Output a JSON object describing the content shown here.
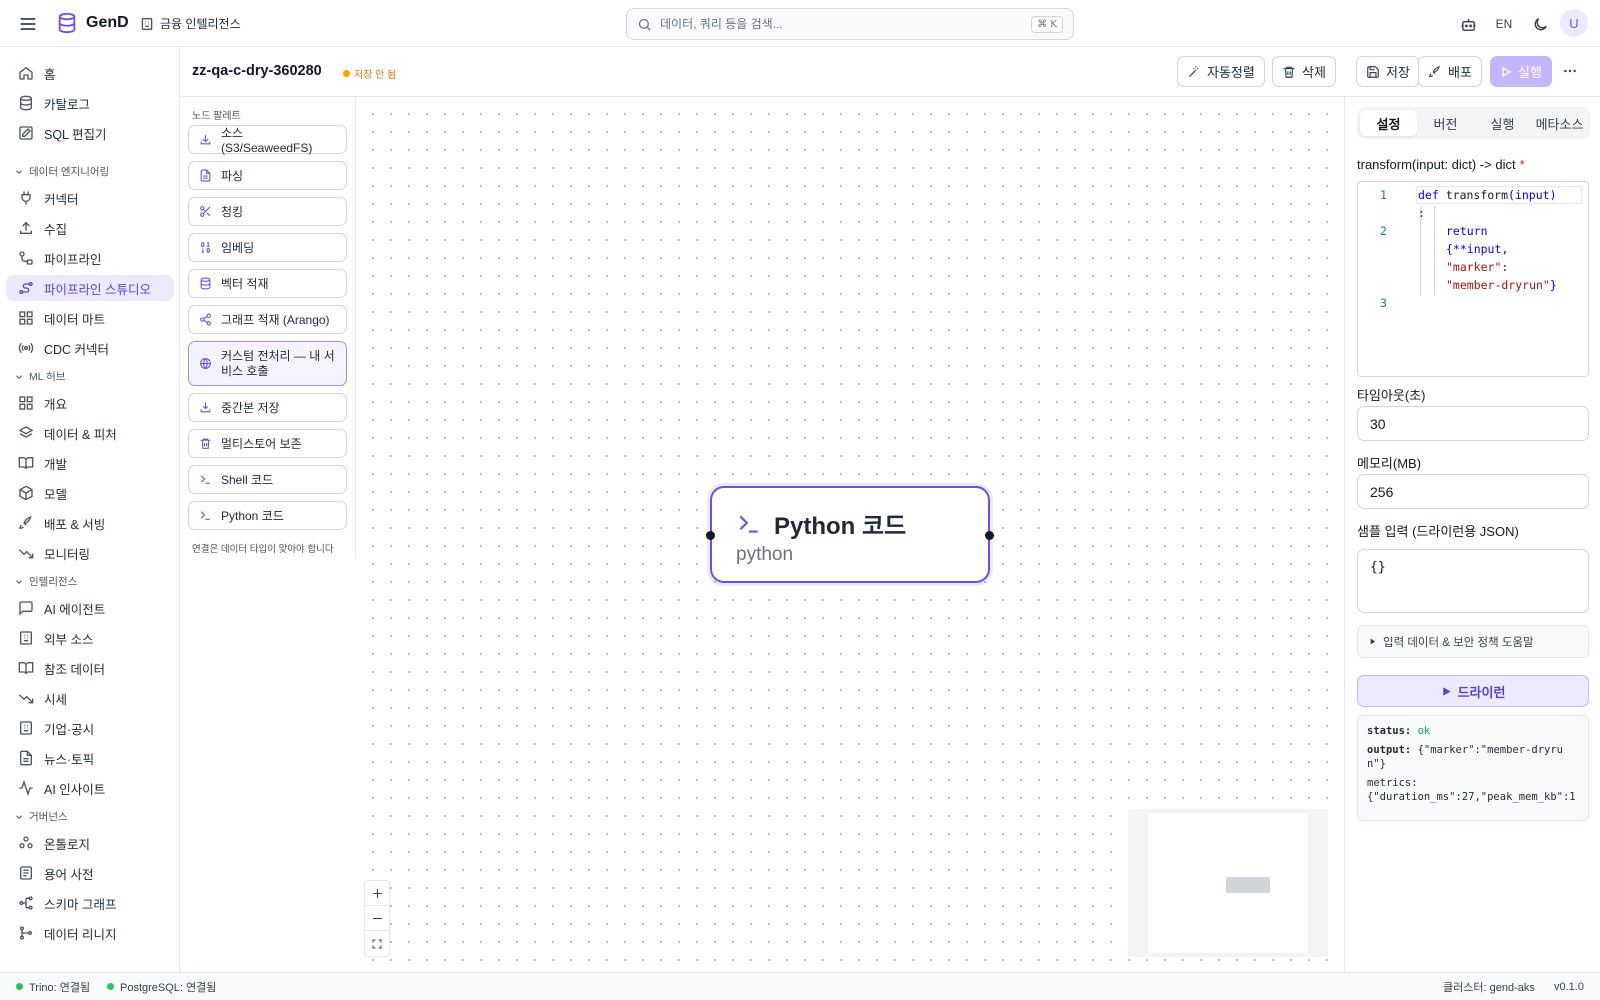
{
  "app": {
    "brand": "GenD",
    "org": "금융 인텔리전스",
    "search_placeholder": "데이터, 쿼리 등을 검색...",
    "search_shortcut": "⌘ K",
    "lang": "EN",
    "avatar": "U"
  },
  "sidebar": {
    "items_top": [
      {
        "label": "홈",
        "icon": "home-icon"
      },
      {
        "label": "카탈로그",
        "icon": "database-icon"
      },
      {
        "label": "SQL 편집기",
        "icon": "edit-icon"
      }
    ],
    "sections": [
      {
        "title": "데이터 엔지니어링",
        "items": [
          {
            "label": "커넥터",
            "icon": "plug-icon"
          },
          {
            "label": "수집",
            "icon": "upload-icon"
          },
          {
            "label": "파이프라인",
            "icon": "workflow-icon"
          },
          {
            "label": "파이프라인 스튜디오",
            "icon": "route-icon",
            "active": true
          },
          {
            "label": "데이터 마트",
            "icon": "grid-icon"
          },
          {
            "label": "CDC 커넥터",
            "icon": "radio-icon"
          }
        ]
      },
      {
        "title": "ML 허브",
        "items": [
          {
            "label": "개요",
            "icon": "grid-icon"
          },
          {
            "label": "데이터 & 피처",
            "icon": "layers-icon"
          },
          {
            "label": "개발",
            "icon": "book-icon"
          },
          {
            "label": "모델",
            "icon": "box-icon"
          },
          {
            "label": "배포 & 서빙",
            "icon": "rocket-icon"
          },
          {
            "label": "모니터링",
            "icon": "trend-icon"
          }
        ]
      },
      {
        "title": "인텔리전스",
        "items": [
          {
            "label": "AI 에이전트",
            "icon": "chat-icon"
          },
          {
            "label": "외부 소스",
            "icon": "building-icon"
          },
          {
            "label": "참조 데이터",
            "icon": "book-icon"
          },
          {
            "label": "시세",
            "icon": "trend-icon"
          },
          {
            "label": "기업·공시",
            "icon": "building-icon"
          },
          {
            "label": "뉴스·토픽",
            "icon": "file-icon"
          },
          {
            "label": "AI 인사이트",
            "icon": "activity-icon"
          }
        ]
      },
      {
        "title": "거버넌스",
        "items": [
          {
            "label": "온톨로지",
            "icon": "ontology-icon"
          },
          {
            "label": "용어 사전",
            "icon": "list-icon"
          },
          {
            "label": "스키마 그래프",
            "icon": "schema-icon"
          },
          {
            "label": "데이터 리니지",
            "icon": "lineage-icon"
          }
        ]
      }
    ]
  },
  "header": {
    "pipeline_name": "zz-qa-c-dry-360280",
    "unsaved": "저장 안 됨",
    "buttons": {
      "autolayout": "자동정렬",
      "delete": "삭제",
      "save": "저장",
      "deploy": "배포",
      "run": "실행"
    }
  },
  "palette": {
    "title": "노드 팔레트",
    "items": [
      {
        "label": "소스 (S3/SeaweedFS)",
        "icon": "download-icon"
      },
      {
        "label": "파싱",
        "icon": "file-icon"
      },
      {
        "label": "청킹",
        "icon": "scissors-icon"
      },
      {
        "label": "임베딩",
        "icon": "binary-icon"
      },
      {
        "label": "벡터 적재",
        "icon": "database-icon"
      },
      {
        "label": "그래프 적재 (Arango)",
        "icon": "share-icon"
      },
      {
        "label": "커스텀 전처리 — 내 서비스 호출",
        "icon": "globe-icon"
      },
      {
        "label": "중간본 저장",
        "icon": "save-down-icon"
      },
      {
        "label": "멀티스토어 보존",
        "icon": "trash-icon"
      },
      {
        "label": "Shell 코드",
        "icon": "terminal-icon"
      },
      {
        "label": "Python 코드",
        "icon": "terminal-icon"
      }
    ],
    "note": "연결은 데이터 타입이 맞아야 합니다"
  },
  "node": {
    "title": "Python 코드",
    "subtitle": "python"
  },
  "panel": {
    "tabs": [
      "설정",
      "버전",
      "실행",
      "메타소스"
    ],
    "active_tab": "설정",
    "code_label": "transform(input: dict) -> dict",
    "required_mark": "*",
    "code": {
      "line_numbers": [
        "1",
        "2",
        "3"
      ],
      "def": "def",
      "fn": "transform",
      "args": "(input)",
      "colon": ":",
      "ret": "return",
      "l1": "{**input,",
      "l2_key": "\"marker\"",
      "l2_colon": ":",
      "l3": "\"member-dryrun\"",
      "l3_end": "}"
    },
    "timeout_label": "타임아웃(초)",
    "timeout_value": "30",
    "memory_label": "메모리(MB)",
    "memory_value": "256",
    "sample_label": "샘플 입력 (드라이런용 JSON)",
    "sample_value": "{}",
    "help_summary": "입력 데이터 & 보안 정책 도움말",
    "dryrun_label": "드라이런",
    "result": {
      "status_key": "status:",
      "status_val": "ok",
      "output_key": "output:",
      "output_val": "{\"marker\":\"member-dryrun\"}",
      "metrics_key": "metrics:",
      "metrics_val": "{\"duration_ms\":27,\"peak_mem_kb\":1"
    }
  },
  "statusbar": {
    "trino": "Trino: 연결됨",
    "postgres": "PostgreSQL: 연결됨",
    "cluster": "클러스터: gend-aks",
    "version": "v0.1.0"
  }
}
